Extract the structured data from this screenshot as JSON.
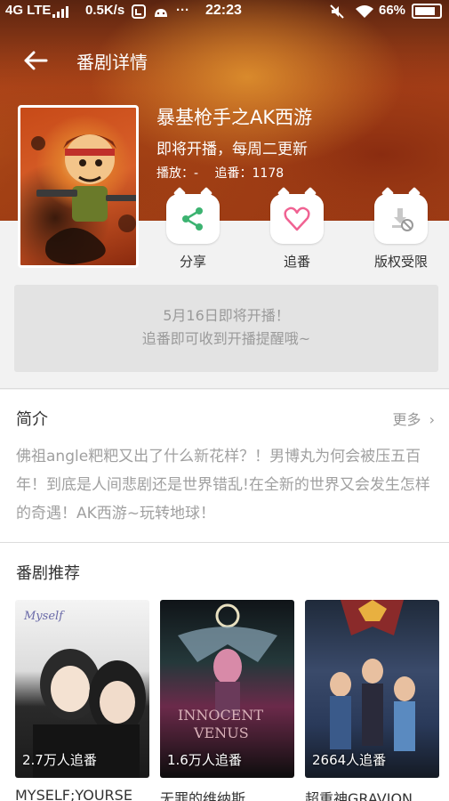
{
  "status_bar": {
    "network": "4G LTE",
    "speed": "0.5K/s",
    "time": "22:23",
    "battery": "66%",
    "icons": [
      "signal-icon",
      "notification-icon",
      "android-icon",
      "more-dots-icon",
      "mute-icon",
      "wifi-icon",
      "battery-icon"
    ]
  },
  "header": {
    "title": "番剧详情",
    "back_icon": "arrow-left-icon"
  },
  "show": {
    "title": "暴基枪手之AK西游",
    "schedule": "即将开播，每周二更新",
    "play_label": "播放：-",
    "follow_label": "追番：1178"
  },
  "actions": [
    {
      "label": "分享",
      "icon": "share-icon",
      "color": "#3cb371"
    },
    {
      "label": "追番",
      "icon": "heart-icon",
      "color": "#f06292"
    },
    {
      "label": "版权受限",
      "icon": "download-disabled-icon",
      "color": "#999999"
    }
  ],
  "notice": {
    "line1": "5月16日即将开播！",
    "line2": "追番即可收到开播提醒哦~"
  },
  "intro": {
    "title": "简介",
    "more": "更多",
    "text": "佛祖angle粑粑又出了什么新花样？！男博丸为何会被压五百年！到底是人间悲剧还是世界错乱!在全新的世界又会发生怎样的奇遇！AK西游~玩转地球！"
  },
  "recommend": {
    "title": "番剧推荐",
    "items": [
      {
        "count": "2.7万人追番",
        "name": "MYSELF;YOURSE"
      },
      {
        "count": "1.6万人追番",
        "name": "无罪的维纳斯"
      },
      {
        "count": "2664人追番",
        "name": "超重神GRAVION"
      }
    ]
  },
  "colors": {
    "accent": "#f06292",
    "share": "#3cb371",
    "hero": "#c25a1e"
  }
}
